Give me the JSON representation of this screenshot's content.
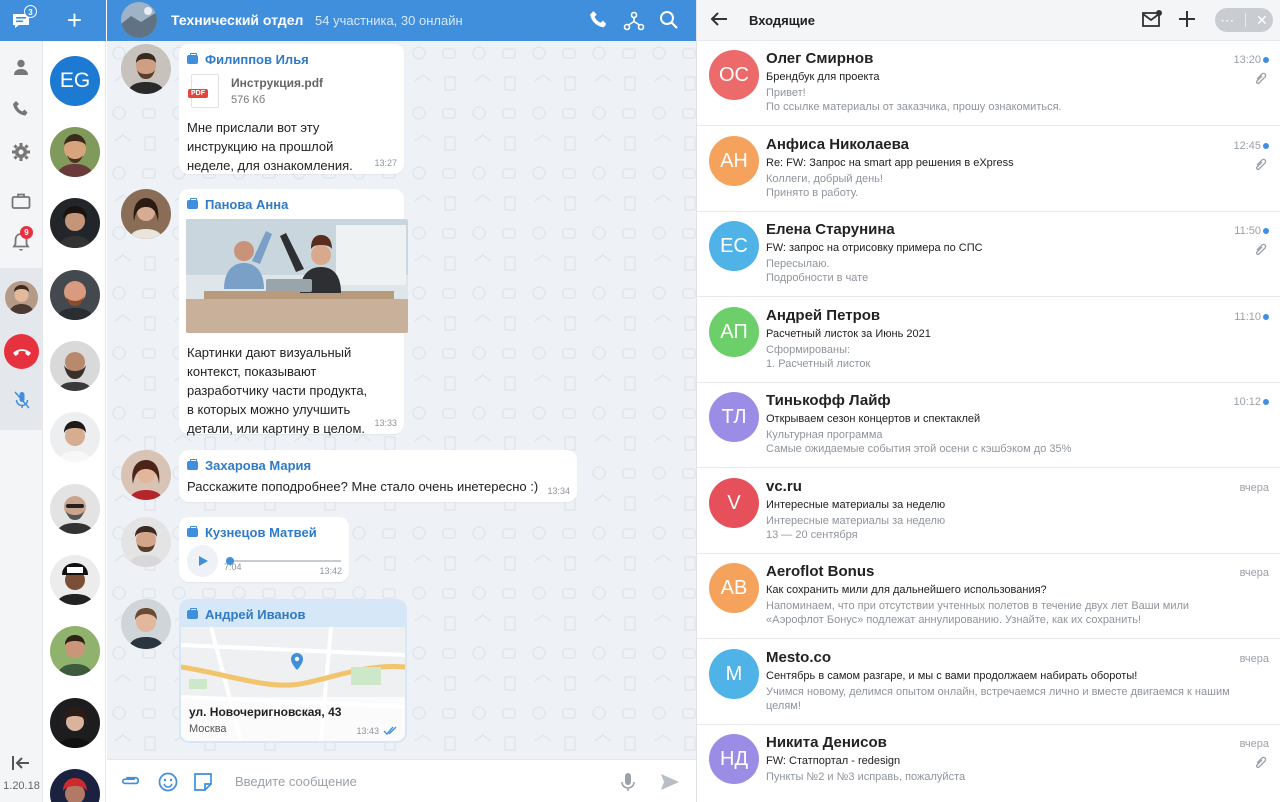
{
  "rail": {
    "chat_badge": "3",
    "notif_badge": "9",
    "version": "1.20.18"
  },
  "contacts": {
    "new_chat": "+",
    "self_initials": "EG"
  },
  "chat": {
    "title": "Технический отдел",
    "subtitle": "54 участника, 30 онлайн",
    "messages": [
      {
        "author": "Филиппов Илья",
        "file_name": "Инструкция.pdf",
        "file_size": "576 Кб",
        "file_type": "PDF",
        "text": "Мне прислали вот эту инструкцию на прошлой неделе, для ознакомления.",
        "time": "13:27"
      },
      {
        "author": "Панова Анна",
        "text": "Картинки дают визуальный контекст, показывают разработчику части продукта, в которых можно улучшить детали, или картину в целом.",
        "time": "13:33"
      },
      {
        "author": "Захарова Мария",
        "text": "Расскажите поподробнее? Мне стало очень инетересно :)",
        "time": "13:34"
      },
      {
        "author": "Кузнецов Матвей",
        "duration": "7:04",
        "time": "13:42"
      },
      {
        "author": "Андрей Иванов",
        "address": "ул. Новочеригновская, 43",
        "city": "Москва",
        "time": "13:43"
      }
    ],
    "composer_placeholder": "Введите сообщение"
  },
  "inbox": {
    "title": "Входящие",
    "items": [
      {
        "initials": "ОС",
        "color": "#ec6a6a",
        "sender": "Олег Смирнов",
        "subject": "Брендбук для проекта",
        "line1": "Привет!",
        "line2": "По ссылке материалы от заказчика, прошу ознакомиться.",
        "time": "13:20",
        "unread": true,
        "attachment": true
      },
      {
        "initials": "АН",
        "color": "#f5a25d",
        "sender": "Анфиса Николаева",
        "subject": "Re: FW: Запрос на smart app решения в eXpress",
        "line1": "Коллеги, добрый день!",
        "line2": "Принято в работу.",
        "time": "12:45",
        "unread": true,
        "attachment": true
      },
      {
        "initials": "ЕС",
        "color": "#4fb3e8",
        "sender": "Елена Старунина",
        "subject": "FW: запрос на отрисовку примера по СПС",
        "line1": "Пересылаю.",
        "line2": "Подробности в чате",
        "time": "11:50",
        "unread": true,
        "attachment": true
      },
      {
        "initials": "АП",
        "color": "#6ccf6a",
        "sender": "Андрей Петров",
        "subject": "Расчетный листок за Июнь 2021",
        "line1": "Сформированы:",
        "line2": "1. Расчетный листок",
        "time": "11:10",
        "unread": true,
        "attachment": false
      },
      {
        "initials": "ТЛ",
        "color": "#9b8ce6",
        "sender": "Тинькофф Лайф",
        "subject": "Открываем сезон концертов и спектаклей",
        "line1": "Культурная программа",
        "line2": "Самые ожидаемые события этой осени с кэшбэком до 35%",
        "time": "10:12",
        "unread": true,
        "attachment": false
      },
      {
        "initials": "V",
        "color": "#e6505a",
        "sender": "vc.ru",
        "subject": "Интересные материалы за неделю",
        "line1": "Интересные материалы за неделю",
        "line2": "13 — 20 сентября",
        "time": "вчера",
        "unread": false,
        "attachment": false
      },
      {
        "initials": "AB",
        "color": "#f5a25d",
        "sender": "Aeroflot Bonus",
        "subject": "Как сохранить мили для дальнейшего использования?",
        "line1": "Напоминаем, что при отсутствии учтенных полетов в течение двух лет Ваши мили",
        "line2": "«Аэрофлот Бонус» подлежат аннулированию. Узнайте, как их сохранить!",
        "time": "вчера",
        "unread": false,
        "attachment": false
      },
      {
        "initials": "M",
        "color": "#4fb3e8",
        "sender": "Mesto.co",
        "subject": "Сентябрь в самом разгаре, и мы с вами продолжаем набирать обороты!",
        "line1": " Учимся новому, делимся опытом онлайн, встречаемся лично и вместе двигаемся к нашим",
        "line2": "целям!",
        "time": "вчера",
        "unread": false,
        "attachment": false
      },
      {
        "initials": "НД",
        "color": "#9b8ce6",
        "sender": "Никита Денисов",
        "subject": "FW: Статпортал - redesign",
        "line1": "Пункты №2 и №3 исправь, пожалуйста",
        "line2": "",
        "time": "вчера",
        "unread": false,
        "attachment": true
      }
    ]
  },
  "colors": {
    "accent": "#3f8fdd",
    "danger": "#e5323e",
    "bubble_bg": "#ffffff",
    "chat_bg": "#eef2f6"
  }
}
